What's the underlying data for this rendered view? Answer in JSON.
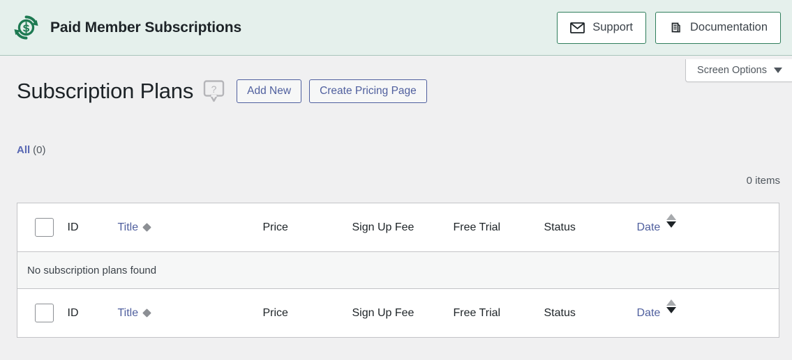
{
  "brand": {
    "logo_icon": "money-cycle-icon",
    "title": "Paid Member Subscriptions",
    "accent_green": "#2e7d5b",
    "bar_background": "#e5f0ec"
  },
  "header_actions": [
    {
      "label": "Support",
      "icon": "envelope-icon"
    },
    {
      "label": "Documentation",
      "icon": "document-pages-icon"
    }
  ],
  "screen_options": {
    "label": "Screen Options",
    "icon": "chevron-down-icon"
  },
  "page": {
    "title": "Subscription Plans",
    "help_icon": "help-question-bubble-icon",
    "buttons": [
      {
        "label": "Add New"
      },
      {
        "label": "Create Pricing Page"
      }
    ],
    "link_color": "#4f5f9e"
  },
  "filters": {
    "all_label": "All",
    "all_count": "(0)"
  },
  "list": {
    "items_count": "0 items",
    "empty_message": "No subscription plans found",
    "columns": [
      {
        "key": "cb",
        "label": "",
        "type": "checkbox"
      },
      {
        "key": "id",
        "label": "ID",
        "type": "plain"
      },
      {
        "key": "title",
        "label": "Title",
        "type": "sortable-diamond"
      },
      {
        "key": "price",
        "label": "Price",
        "type": "plain"
      },
      {
        "key": "fee",
        "label": "Sign Up Fee",
        "type": "plain"
      },
      {
        "key": "trial",
        "label": "Free Trial",
        "type": "plain"
      },
      {
        "key": "status",
        "label": "Status",
        "type": "plain"
      },
      {
        "key": "date",
        "label": "Date",
        "type": "sortable-arrows"
      }
    ],
    "rows": []
  }
}
